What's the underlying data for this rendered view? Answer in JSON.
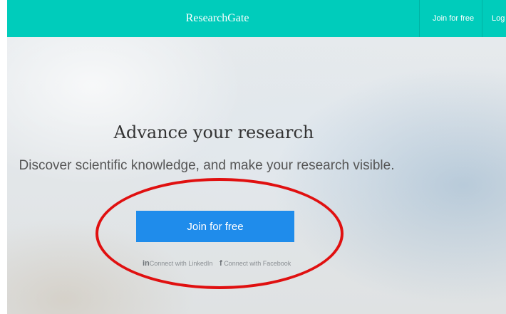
{
  "topbar": {
    "brand": "ResearchGate",
    "join_label": "Join for free",
    "login_label": "Log in",
    "background": "#00ccbb"
  },
  "hero": {
    "title": "Advance your research",
    "subtitle": "Discover scientific knowledge, and make your research visible.",
    "cta_label": "Join for free",
    "cta_color": "#1f8ceb"
  },
  "social": {
    "linkedin_glyph": "in",
    "linkedin_label": "Connect with LinkedIn",
    "facebook_glyph": "f",
    "facebook_label": "Connect with Facebook"
  },
  "annotation": {
    "shape": "ellipse",
    "color": "#e01010",
    "target": "Join for free"
  }
}
